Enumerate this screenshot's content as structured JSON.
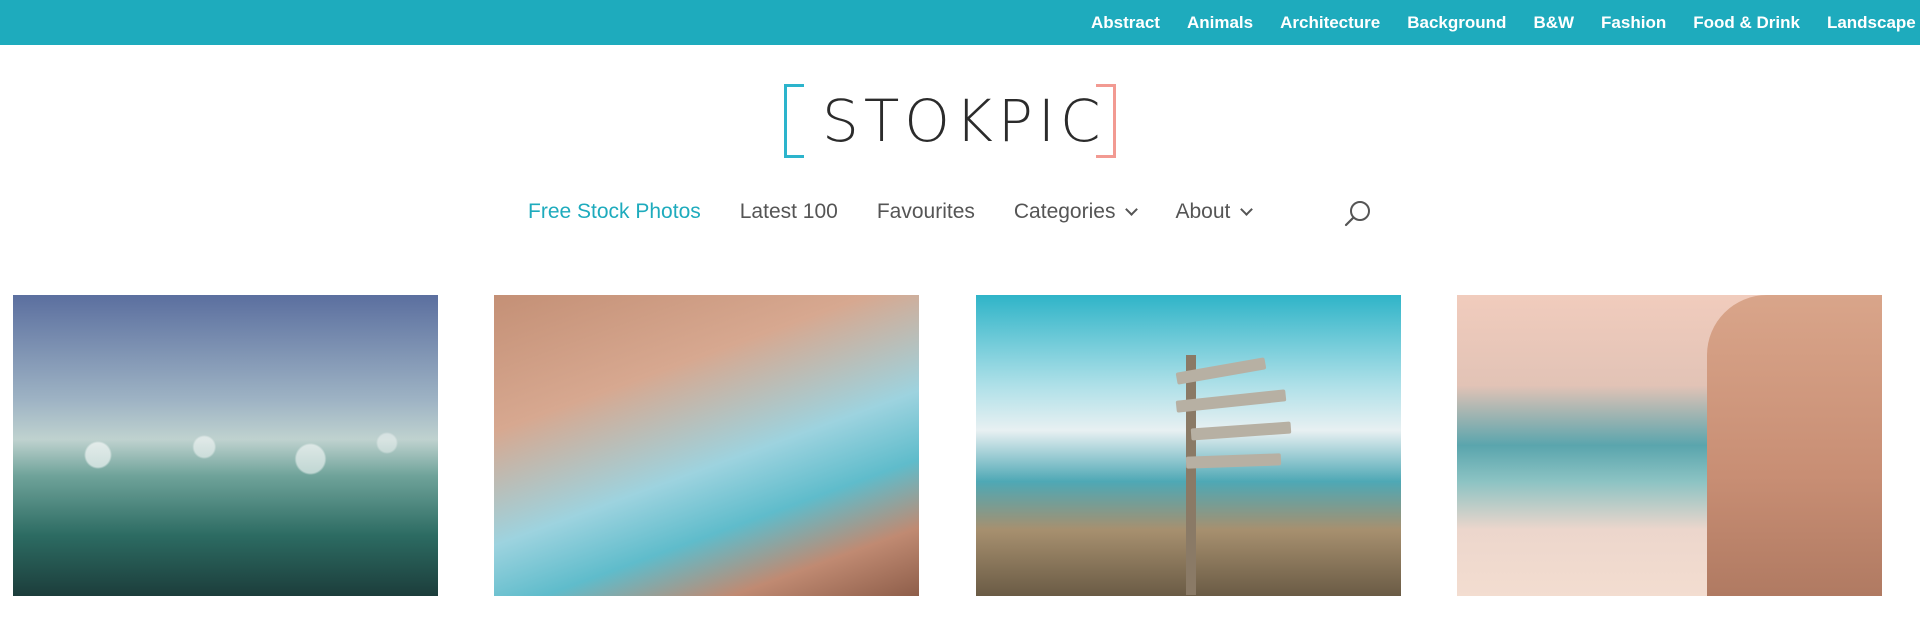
{
  "topbar": {
    "categories": [
      "Abstract",
      "Animals",
      "Architecture",
      "Background",
      "B&W",
      "Fashion",
      "Food & Drink",
      "Landscape"
    ]
  },
  "logo": {
    "text": "STOKPIC"
  },
  "nav": {
    "items": [
      {
        "label": "Free Stock Photos",
        "active": true
      },
      {
        "label": "Latest 100"
      },
      {
        "label": "Favourites"
      },
      {
        "label": "Categories",
        "dropdown": true
      },
      {
        "label": "About",
        "dropdown": true
      }
    ],
    "search_icon": "search-icon"
  },
  "photos": [
    {
      "subject": "water-splash-photo"
    },
    {
      "subject": "couple-beach-photo"
    },
    {
      "subject": "signpost-beach-photo"
    },
    {
      "subject": "sand-splash-bikini-photo"
    }
  ],
  "colors": {
    "accent": "#1eabbd",
    "logo_left": "#2cb4cc",
    "logo_right": "#f29a92"
  }
}
